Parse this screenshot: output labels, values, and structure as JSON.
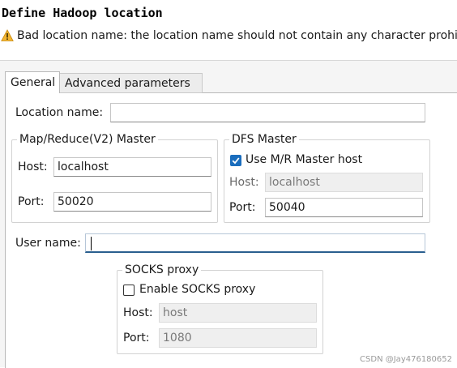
{
  "dialog": {
    "title": "Define Hadoop location",
    "message": "Bad location name: the location name should not contain any character prohibited in a file name."
  },
  "tabs": [
    {
      "label": "General",
      "selected": true
    },
    {
      "label": "Advanced parameters",
      "selected": false
    }
  ],
  "general": {
    "location_name_label": "Location name:",
    "location_name_value": "",
    "mapred": {
      "title": "Map/Reduce(V2) Master",
      "host_label": "Host:",
      "host_value": "localhost",
      "port_label": "Port:",
      "port_value": "50020"
    },
    "dfs": {
      "title": "DFS Master",
      "use_mr_host_label": "Use M/R Master host",
      "use_mr_host_checked": true,
      "host_label": "Host:",
      "host_value": "localhost",
      "port_label": "Port:",
      "port_value": "50040"
    },
    "user_name_label": "User name:",
    "user_name_value": "",
    "socks": {
      "title": "SOCKS proxy",
      "enable_label": "Enable SOCKS proxy",
      "enable_checked": false,
      "host_label": "Host:",
      "host_value": "host",
      "port_label": "Port:",
      "port_value": "1080"
    }
  },
  "watermark": "CSDN @Jay476180652",
  "colors": {
    "accent": "#1a6dbd",
    "warning": "#e8a317"
  }
}
